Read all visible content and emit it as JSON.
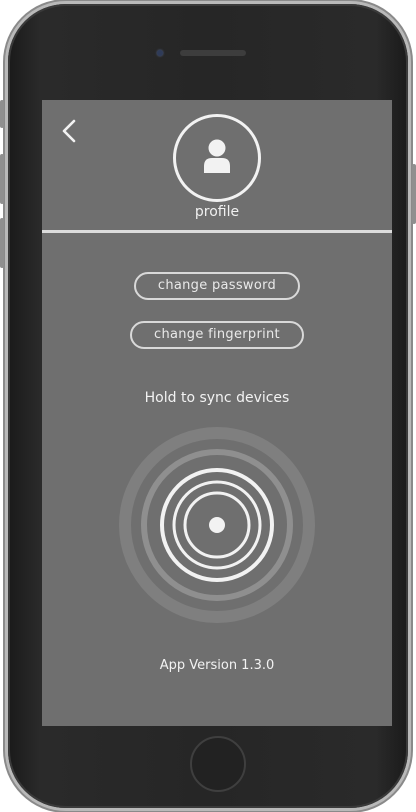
{
  "screen": {
    "back_icon": "chevron-left-icon",
    "profile_icon": "user-icon",
    "profile_label": "profile",
    "buttons": {
      "change_password": "change password",
      "change_fingerprint": "change fingerprint"
    },
    "sync_prompt": "Hold to sync devices",
    "sync_icon": "concentric-rings-icon",
    "app_version": "App Version 1.3.0"
  },
  "colors": {
    "screen_background": "#6f6f6f",
    "foreground": "#f2f2f2",
    "phone_body": "#262626"
  }
}
